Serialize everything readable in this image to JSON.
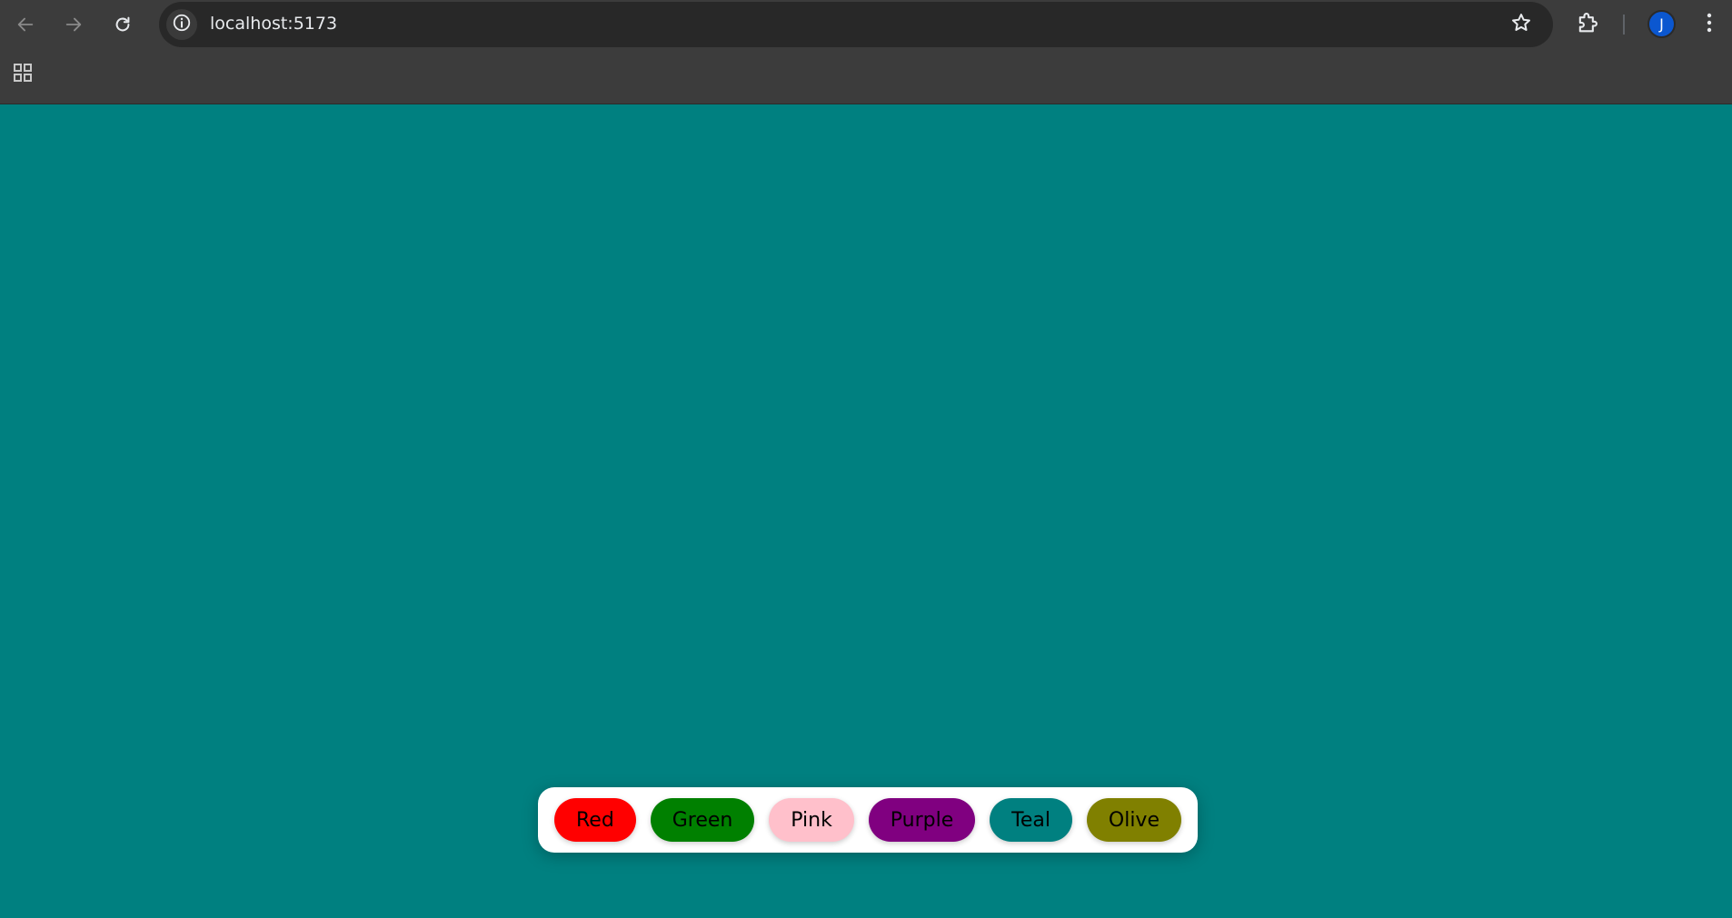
{
  "browser": {
    "url": "localhost:5173",
    "profile_initial": "J",
    "icons": {
      "back": "arrow-left-icon",
      "forward": "arrow-right-icon",
      "reload": "reload-icon",
      "site_info": "info-icon",
      "bookmark": "star-icon",
      "extensions": "puzzle-icon",
      "menu": "kebab-menu-icon",
      "apps": "apps-grid-icon"
    }
  },
  "page": {
    "background_color": "#008080"
  },
  "palette": {
    "buttons": [
      {
        "label": "Red",
        "color": "#ff0000"
      },
      {
        "label": "Green",
        "color": "#008000"
      },
      {
        "label": "Pink",
        "color": "#ffc0cb"
      },
      {
        "label": "Purple",
        "color": "#800080"
      },
      {
        "label": "Teal",
        "color": "#008080"
      },
      {
        "label": "Olive",
        "color": "#808000"
      }
    ]
  }
}
